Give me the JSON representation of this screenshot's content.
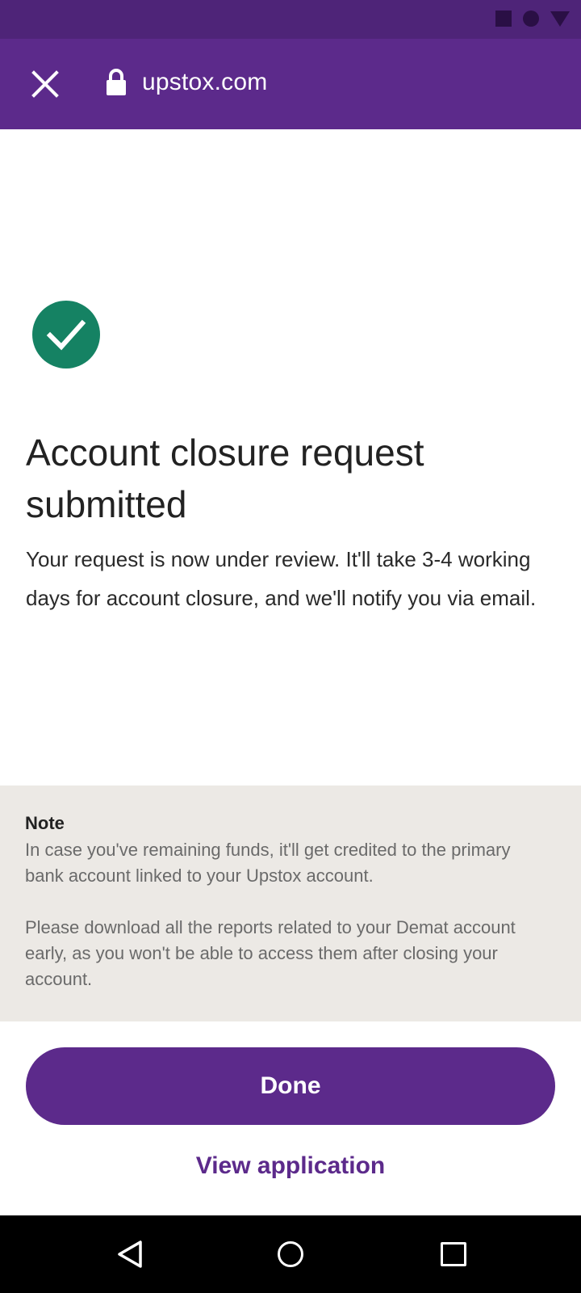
{
  "status_bar": {
    "icons": [
      "square-icon",
      "circle-icon",
      "triangle-icon"
    ]
  },
  "browser": {
    "url": "upstox.com",
    "close_icon": "close-icon",
    "lock_icon": "lock-icon"
  },
  "confirmation": {
    "icon": "check-circle-icon",
    "title": "Account closure request submitted",
    "description": "Your request is now under review. It'll take 3-4 working days for account closure, and we'll notify you via email."
  },
  "note": {
    "heading": "Note",
    "paragraph_1": "In case you've remaining funds, it'll get credited to the primary bank account linked to your Upstox account.",
    "paragraph_2": "Please download all the reports related to your Demat account early, as you won't be able to access them after closing your account."
  },
  "actions": {
    "done_label": "Done",
    "view_application_label": "View application"
  },
  "nav_bar": {
    "icons": [
      "back-icon",
      "home-icon",
      "recents-icon"
    ]
  },
  "colors": {
    "brand": "#5c2a8b",
    "status_bar": "#4e2478",
    "success": "#158263",
    "note_bg": "#ece9e5"
  }
}
